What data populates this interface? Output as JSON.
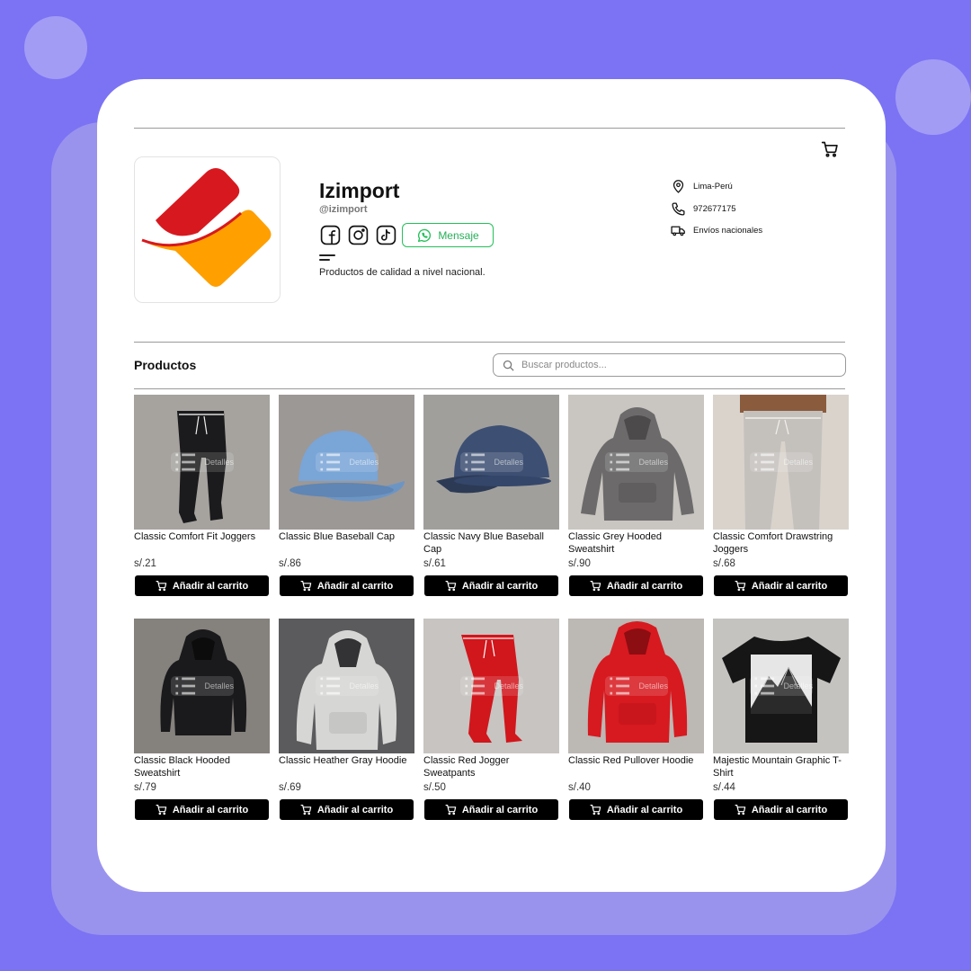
{
  "store": {
    "name": "Izimport",
    "handle": "@izimport",
    "description": "Productos de calidad a nivel nacional.",
    "message_label": "Mensaje",
    "brand_colors": {
      "red": "#d7191f",
      "orange": "#ff9f00"
    },
    "social_icons": [
      "facebook-icon",
      "instagram-icon",
      "tiktok-icon",
      "whatsapp-icon"
    ]
  },
  "info": {
    "location": "Lima-Perú",
    "phone": "972677175",
    "shipping": "Envíos nacionales"
  },
  "products_section": {
    "title": "Productos",
    "search_placeholder": "Buscar productos..."
  },
  "product_card": {
    "details_label": "Detalles",
    "add_to_cart_label": "Añadir al carrito"
  },
  "products": [
    {
      "name": "Classic Comfort Fit Joggers",
      "price": "s/.21",
      "image": "black-joggers"
    },
    {
      "name": "Classic Blue Baseball Cap",
      "price": "s/.86",
      "image": "light-blue-cap"
    },
    {
      "name": "Classic Navy Blue Baseball Cap",
      "price": "s/.61",
      "image": "navy-cap"
    },
    {
      "name": "Classic Grey Hooded Sweatshirt",
      "price": "s/.90",
      "image": "grey-hoodie"
    },
    {
      "name": "Classic Comfort Drawstring Joggers",
      "price": "s/.68",
      "image": "grey-joggers-worn"
    },
    {
      "name": "Classic Black Hooded Sweatshirt",
      "price": "s/.79",
      "image": "black-hoodie"
    },
    {
      "name": "Classic Heather Gray Hoodie",
      "price": "s/.69",
      "image": "heather-gray-hoodie"
    },
    {
      "name": "Classic Red Jogger Sweatpants",
      "price": "s/.50",
      "image": "red-joggers"
    },
    {
      "name": "Classic Red Pullover Hoodie",
      "price": "s/.40",
      "image": "red-hoodie"
    },
    {
      "name": "Majestic Mountain Graphic T-Shirt",
      "price": "s/.44",
      "image": "mountain-tshirt"
    }
  ],
  "colors": {
    "background": "#7b73f4",
    "accent_green": "#25c05a",
    "button_black": "#000000"
  }
}
